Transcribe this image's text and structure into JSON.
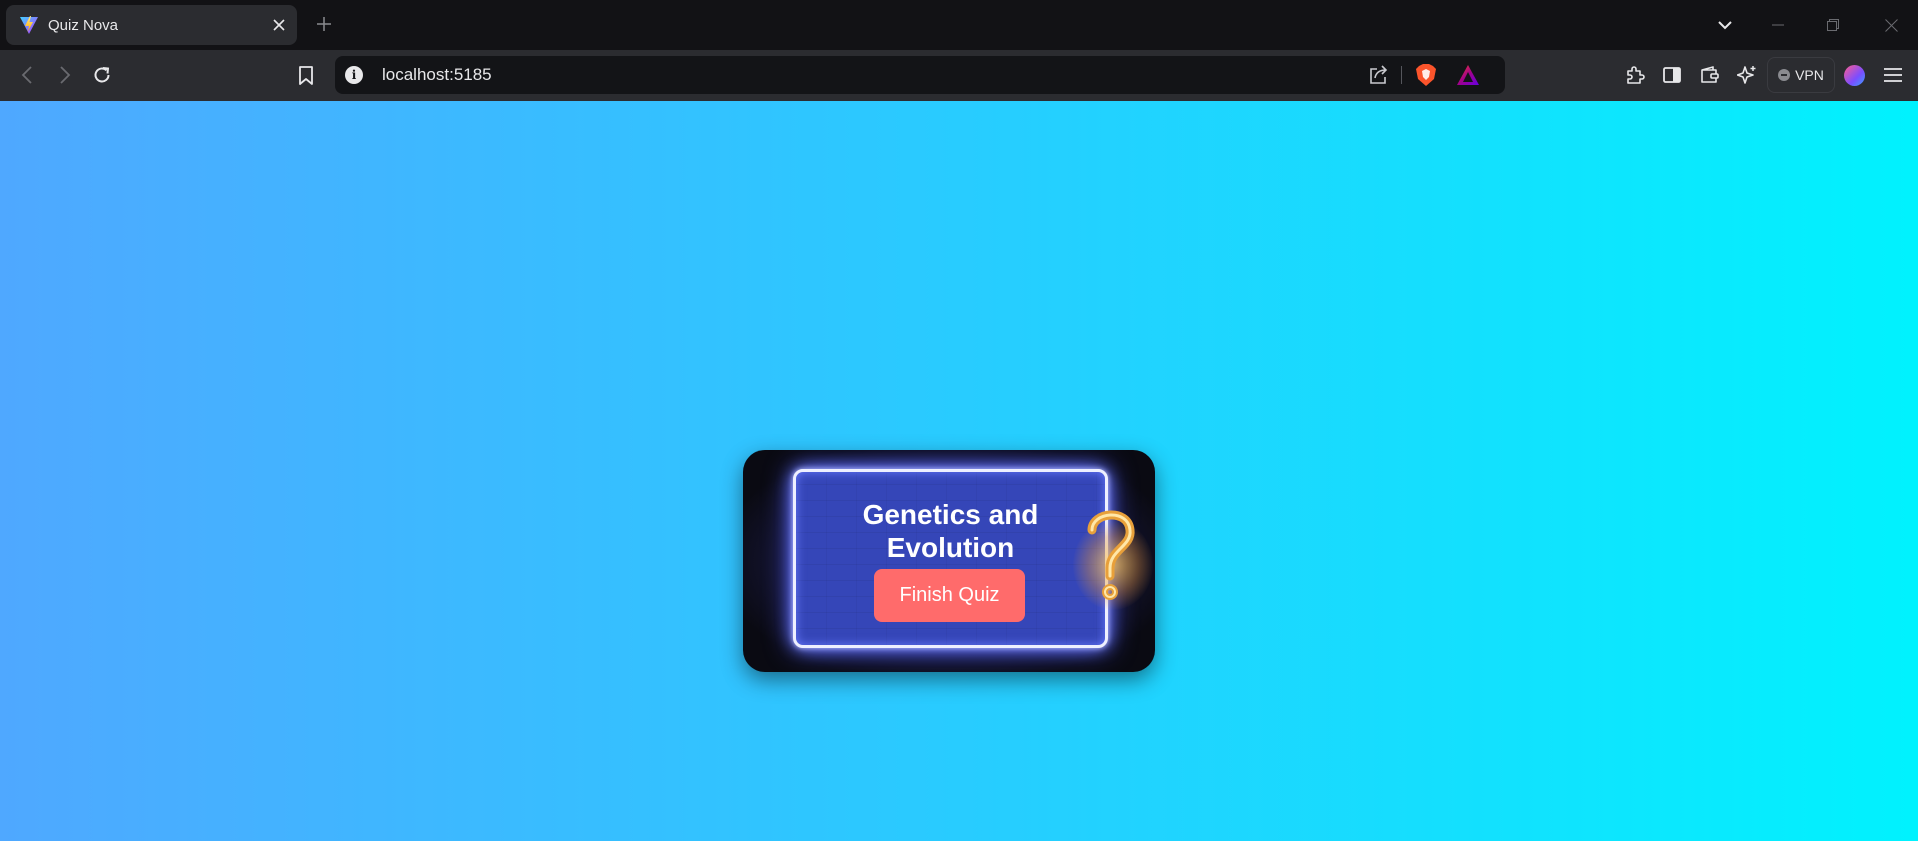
{
  "browser": {
    "tab": {
      "title": "Quiz Nova",
      "favicon": "vite-logo-icon",
      "close_icon": "close-icon"
    },
    "new_tab_icon": "plus-icon",
    "tab_list_icon": "chevron-down-icon",
    "window_controls": [
      "minimize-icon",
      "restore-icon",
      "close-window-icon"
    ],
    "toolbar": {
      "nav_icons": [
        "back-arrow-icon",
        "forward-arrow-icon",
        "reload-icon"
      ],
      "bookmark_icon": "bookmark-icon",
      "address": {
        "info_icon": "info-icon",
        "info_glyph": "i",
        "url": "localhost:5185"
      },
      "right_icons": [
        "extensions-icon",
        "sidebar-icon",
        "wallet-icon",
        "leo-ai-icon",
        "menu-icon"
      ],
      "vpn_label": "VPN"
    }
  },
  "page": {
    "background_gradient": [
      "#4fa8ff",
      "#00f2fe"
    ],
    "card": {
      "title": "Genetics and Evolution",
      "button_label": "Finish Quiz",
      "button_color": "#ff6b6b",
      "frame_color": "#3546b8",
      "decoration": "neon-question-mark-icon"
    }
  }
}
